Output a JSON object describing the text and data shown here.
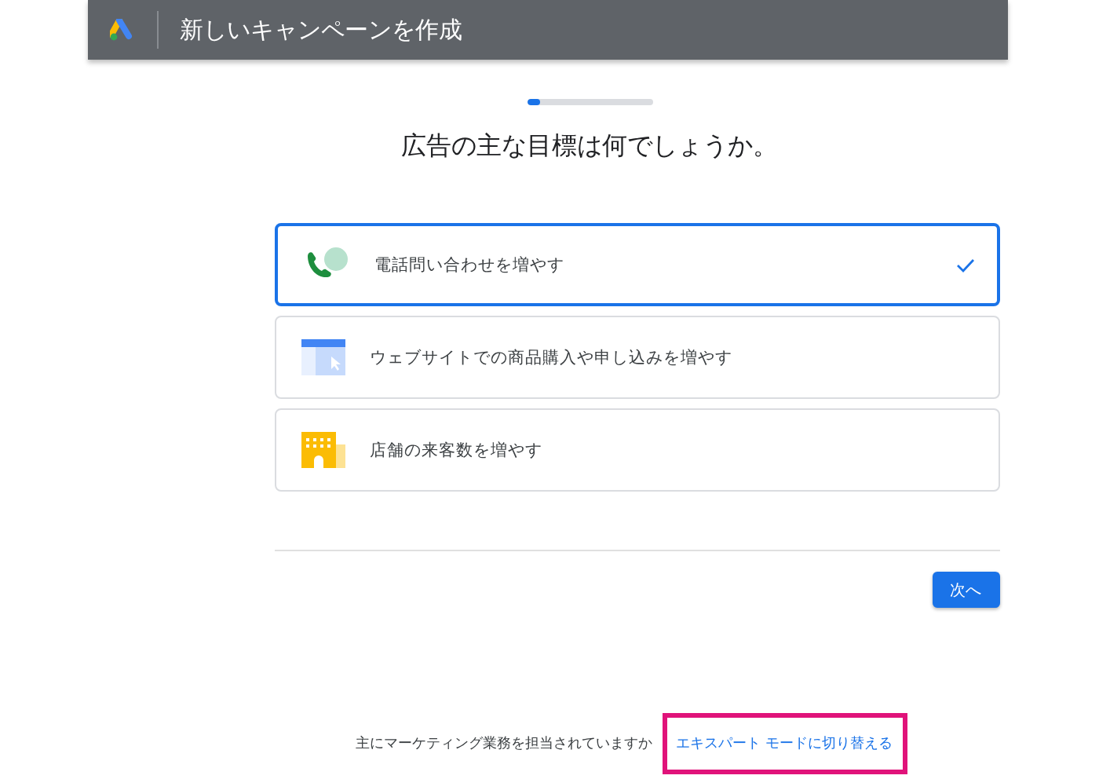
{
  "header": {
    "title": "新しいキャンペーンを作成"
  },
  "progress": {
    "level": 0.1
  },
  "heading": "広告の主な目標は何でしょうか。",
  "goals": [
    {
      "kind": "phone",
      "label": "電話問い合わせを増やす",
      "selected": true
    },
    {
      "kind": "website",
      "label": "ウェブサイトでの商品購入や申し込みを増やす",
      "selected": false
    },
    {
      "kind": "store",
      "label": "店舗の来客数を増やす",
      "selected": false
    }
  ],
  "next_button": "次へ",
  "footer": {
    "text": "主にマーケティング業務を担当されていますか",
    "link": "エキスパート モードに切り替える",
    "link_highlighted": true
  }
}
